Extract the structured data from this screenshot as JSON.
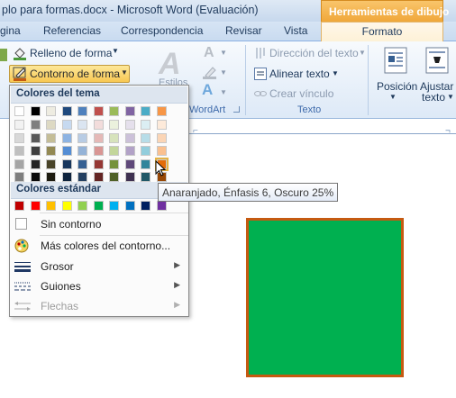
{
  "window": {
    "title": "plo para formas.docx - Microsoft Word (Evaluación)",
    "contextual_tools": "Herramientas de dibujo"
  },
  "tabs": {
    "items": [
      "gina",
      "Referencias",
      "Correspondencia",
      "Revisar",
      "Vista"
    ],
    "active": "Formato"
  },
  "ribbon": {
    "shape_fill": "Relleno de forma",
    "shape_outline": "Contorno de forma",
    "styles_partial": "Estilos",
    "wordart_label": "WordArt",
    "text_direction": "Dirección del texto",
    "align_text": "Alinear texto",
    "create_link": "Crear vínculo",
    "text_group": "Texto",
    "position": "Posición",
    "wrap_text_1": "Ajustar",
    "wrap_text_2": "texto"
  },
  "menu": {
    "theme_colors_label": "Colores del tema",
    "standard_colors_label": "Colores estándar",
    "no_outline": "Sin contorno",
    "more_colors": "Más colores del contorno...",
    "weight": "Grosor",
    "dashes": "Guiones",
    "arrows": "Flechas",
    "theme_colors": [
      [
        "#ffffff",
        "#000000",
        "#eeece1",
        "#1f497d",
        "#4f81bd",
        "#c0504d",
        "#9bbb59",
        "#8064a2",
        "#4bacc6",
        "#f79646"
      ],
      [
        "#f2f2f2",
        "#7f7f7f",
        "#ddd9c3",
        "#c6d9f0",
        "#dbe5f1",
        "#f2dcdb",
        "#ebf1dd",
        "#e5e0ec",
        "#dbeef3",
        "#fdeada"
      ],
      [
        "#d8d8d8",
        "#595959",
        "#c4bd97",
        "#8db3e2",
        "#b8cce4",
        "#e5b9b7",
        "#d7e3bc",
        "#ccc1d9",
        "#b7dde8",
        "#fbd5b5"
      ],
      [
        "#bfbfbf",
        "#3f3f3f",
        "#938953",
        "#548dd4",
        "#95b3d7",
        "#d99694",
        "#c3d69b",
        "#b2a2c7",
        "#92cddc",
        "#fac08f"
      ],
      [
        "#a5a5a5",
        "#262626",
        "#494429",
        "#17365d",
        "#366092",
        "#953734",
        "#76923c",
        "#5f497a",
        "#31859b",
        "#e36c09"
      ],
      [
        "#7f7f7f",
        "#0c0c0c",
        "#1d1b10",
        "#0f243e",
        "#244061",
        "#632423",
        "#4f6128",
        "#3f3151",
        "#205867",
        "#974806"
      ]
    ],
    "standard_colors": [
      "#c00000",
      "#ff0000",
      "#ffc000",
      "#ffff00",
      "#92d050",
      "#00b050",
      "#00b0f0",
      "#0070c0",
      "#002060",
      "#7030a0"
    ]
  },
  "tooltip": "Anaranjado, Énfasis 6, Oscuro 25%",
  "colors": {
    "shape_fill": "#00b050",
    "shape_outline": "#c55a11",
    "accent_orange": "#f0a73a"
  }
}
